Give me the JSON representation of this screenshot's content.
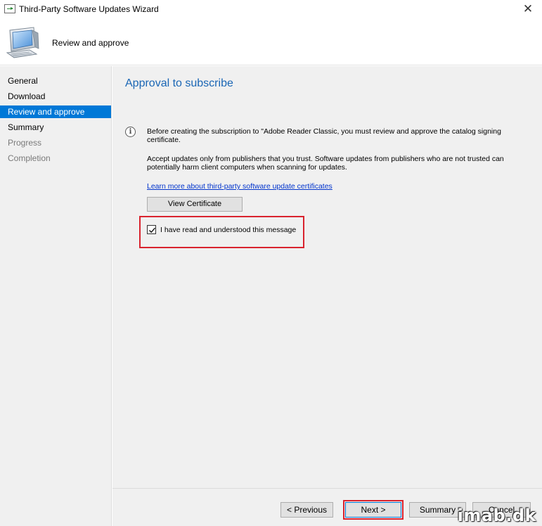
{
  "window": {
    "title": "Third-Party Software Updates Wizard",
    "close_symbol": "✕"
  },
  "header": {
    "text": "Review and approve",
    "icon": "computer-monitor-icon"
  },
  "sidebar": {
    "items": [
      {
        "label": "General",
        "state": "normal"
      },
      {
        "label": "Download",
        "state": "normal"
      },
      {
        "label": "Review and approve",
        "state": "active"
      },
      {
        "label": "Summary",
        "state": "normal"
      },
      {
        "label": "Progress",
        "state": "disabled"
      },
      {
        "label": "Completion",
        "state": "disabled"
      }
    ]
  },
  "main": {
    "title": "Approval to subscribe",
    "info_symbol": "i",
    "message1": "Before creating the subscription to \"Adobe Reader Classic, you must review and approve the catalog signing certificate.",
    "message2": "Accept updates only from publishers that you trust. Software updates from publishers who are not trusted can potentially harm client computers when scanning for updates.",
    "link": "Learn more about third-party software update certificates",
    "view_cert_button": "View Certificate",
    "checkbox_label": "I have read and understood this message",
    "checkbox_checked": true
  },
  "footer": {
    "previous": "< Previous",
    "next": "Next >",
    "summary": "Summary",
    "cancel": "Cancel"
  },
  "watermark": "imab.dk",
  "colors": {
    "accent": "#0078d7",
    "title_blue": "#1a66b5",
    "highlight_red": "#d9232e"
  }
}
